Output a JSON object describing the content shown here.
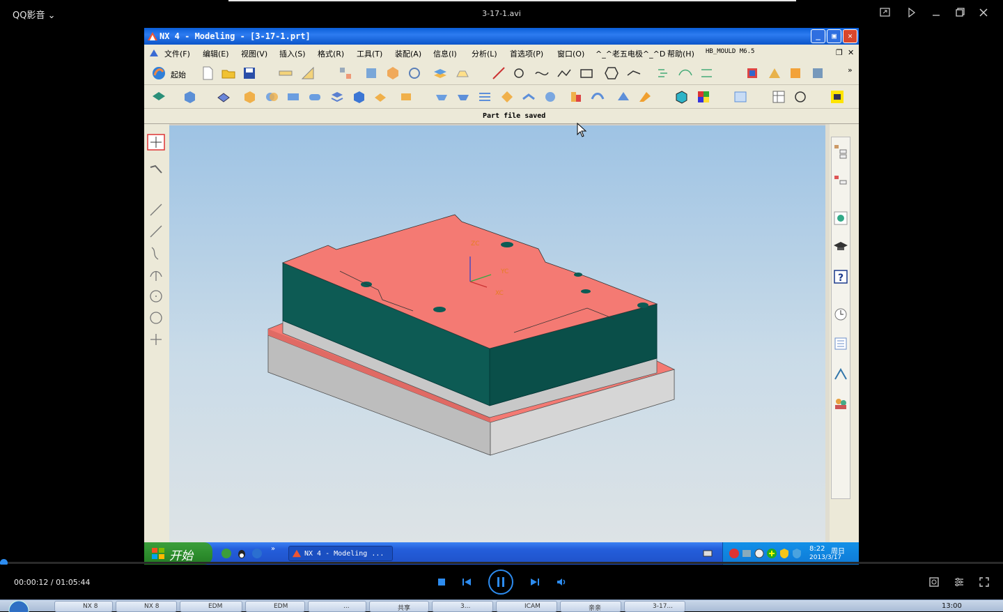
{
  "player": {
    "brand": "QQ影音",
    "brand_caret": "⌄",
    "video_title": "3-17-1.avi",
    "time_current": "00:00:12",
    "time_total": "01:05:44",
    "time_sep": " / ",
    "progress_fraction": 0.003
  },
  "nx_window": {
    "title": "NX 4 - Modeling - [3-17-1.prt]",
    "menus": [
      "文件(F)",
      "编辑(E)",
      "视图(V)",
      "插入(S)",
      "格式(R)",
      "工具(T)",
      "装配(A)",
      "信息(I)",
      "分析(L)",
      "首选项(P)",
      "窗口(O)",
      "^_^老五电极^_^D",
      "帮助(H)",
      "HB_MOULD M6.5"
    ],
    "start_label": "起始",
    "status_text": "Part file saved"
  },
  "viewport_axes": {
    "zc": "ZC",
    "yc": "YC",
    "xc": "XC"
  },
  "xp_taskbar": {
    "start_label": "开始",
    "task_label": "NX 4 - Modeling ...",
    "clock_time": "8:22",
    "clock_day": "周日",
    "clock_date": "2013/3/17"
  },
  "host_taskbar": {
    "clock": "13:00",
    "items": [
      "NX 8",
      "NX 8",
      "EDM",
      "EDM",
      "...",
      "共享",
      "3...",
      "ICAM",
      "亲亲",
      "3-17..."
    ]
  },
  "colors": {
    "model_top": "#f47a73",
    "model_wall": "#0d5b54",
    "plate_gray": "#c8c8c8",
    "accent_blue": "#2d8cf0"
  }
}
